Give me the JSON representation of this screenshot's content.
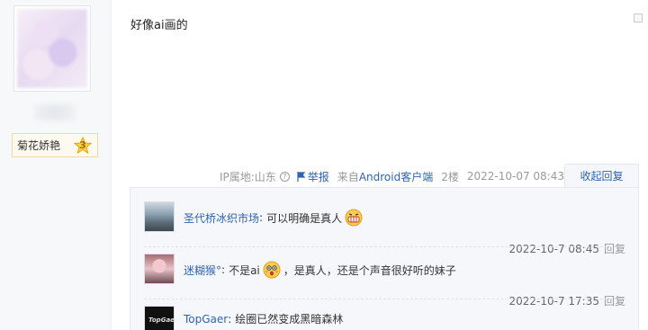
{
  "author": {
    "level_name": "菊花娇艳",
    "level_num": "3"
  },
  "post": {
    "content": "好像ai画的",
    "ip_location": "IP属地:山东",
    "report_label": "举报",
    "from_prefix": "来自",
    "from_client": "Android客户端",
    "floor": "2楼",
    "time": "2022-10-07 08:43",
    "collapse_label": "收起回复"
  },
  "replies": [
    {
      "name": "圣代桥冰织市场",
      "separator": ":",
      "text_before": "可以明确是真人",
      "emoji": "grinning-face-icon",
      "text_after": "",
      "time": "2022-10-7 08:45",
      "reply_label": "回复"
    },
    {
      "name": "迷糊猴°",
      "separator": ":",
      "text_before": "不是ai",
      "emoji": "surprised-face-icon",
      "text_after": "，是真人，还是个声音很好听的妹子",
      "time": "2022-10-7 17:35",
      "reply_label": "回复"
    },
    {
      "name": "TopGaer",
      "separator": ":",
      "text_before": "绘圈已然变成黑暗森林",
      "avatar_text": "TopGaer"
    }
  ],
  "colors": {
    "link": "#2d64b3",
    "meta": "#999999",
    "reply_bg": "#f6f7fa"
  }
}
